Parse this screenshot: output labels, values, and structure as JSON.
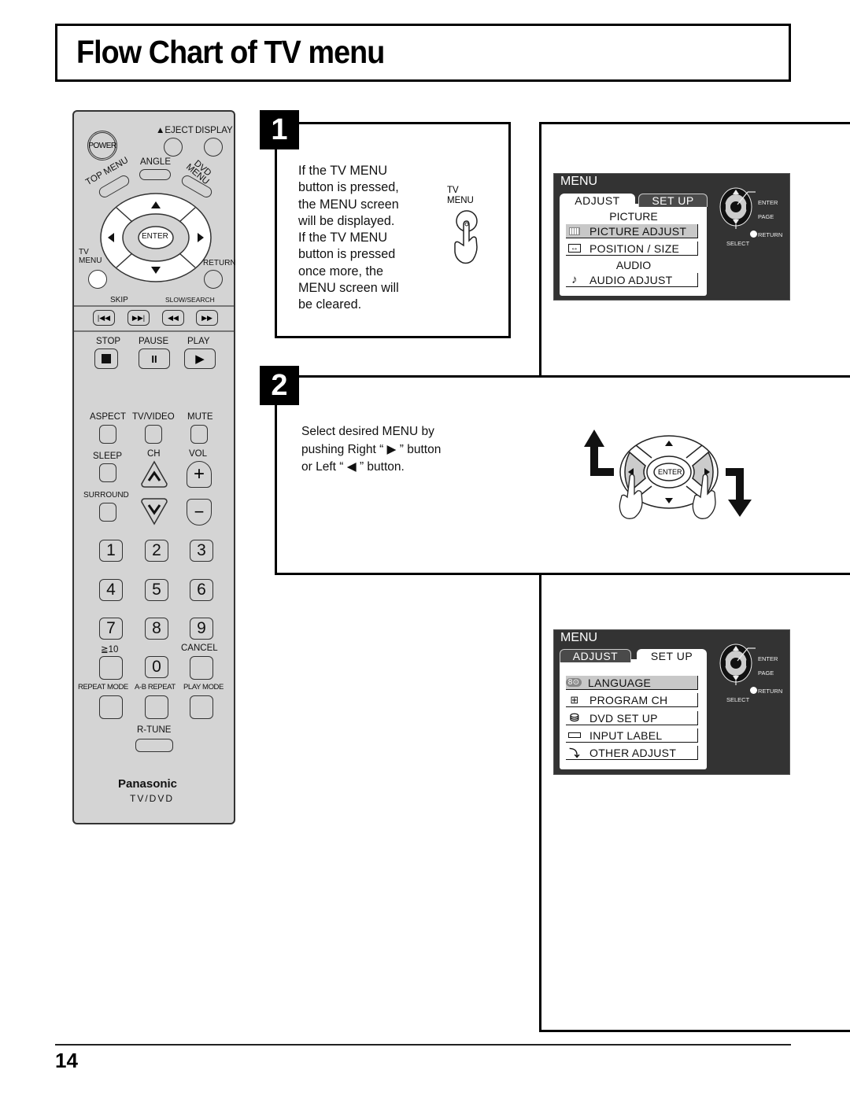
{
  "title": "Flow Chart of TV menu",
  "page_number": "14",
  "remote": {
    "power": "POWER",
    "eject": "▲EJECT",
    "display": "DISPLAY",
    "angle": "ANGLE",
    "top_menu": "TOP MENU",
    "dvd_menu": "DVD MENU",
    "enter": "ENTER",
    "tv_menu_line1": "TV",
    "tv_menu_line2": "MENU",
    "return": "RETURN",
    "skip": "SKIP",
    "slow_search": "SLOW/SEARCH",
    "stop": "STOP",
    "pause": "PAUSE",
    "play": "PLAY",
    "aspect": "ASPECT",
    "tv_video": "TV/VIDEO",
    "mute": "MUTE",
    "sleep": "SLEEP",
    "ch": "CH",
    "vol": "VOL",
    "surround": "SURROUND",
    "numbers": [
      "1",
      "2",
      "3",
      "4",
      "5",
      "6",
      "7",
      "8",
      "9",
      "0"
    ],
    "ge10": "≧10",
    "cancel": "CANCEL",
    "repeat_mode": "REPEAT MODE",
    "ab_repeat": "A-B REPEAT",
    "play_mode": "PLAY MODE",
    "r_tune": "R-TUNE",
    "brand": "Panasonic",
    "model": "TV/DVD"
  },
  "step1": {
    "number": "1",
    "lines": [
      "If the TV MENU",
      "button is pressed,",
      "the MENU screen",
      "will be displayed.",
      "If the TV MENU",
      "button is pressed",
      "once more, the",
      "MENU screen will",
      "be cleared."
    ],
    "button_label_line1": "TV",
    "button_label_line2": "MENU"
  },
  "step2": {
    "number": "2",
    "lines": [
      "Select desired MENU by",
      "pushing Right “ ▶ ” button",
      "or Left “ ◀ ” button."
    ],
    "enter_label": "ENTER"
  },
  "menu_adjust": {
    "title": "MENU",
    "tabs": [
      {
        "label": "ADJUST",
        "active": true
      },
      {
        "label": "SET UP",
        "active": false
      }
    ],
    "sections": [
      {
        "heading": "PICTURE",
        "items": [
          {
            "icon": "picture-adjust-icon",
            "label": "PICTURE ADJUST",
            "highlighted": true
          },
          {
            "icon": "position-size-icon",
            "label": "POSITION / SIZE",
            "highlighted": false
          }
        ]
      },
      {
        "heading": "AUDIO",
        "items": [
          {
            "icon": "music-note-icon",
            "label": "AUDIO ADJUST",
            "highlighted": false
          }
        ]
      }
    ],
    "legend": {
      "enter": "ENTER",
      "page": "PAGE",
      "return": "RETURN",
      "select": "SELECT"
    }
  },
  "menu_setup": {
    "title": "MENU",
    "tabs": [
      {
        "label": "ADJUST",
        "active": false
      },
      {
        "label": "SET UP",
        "active": true
      }
    ],
    "items": [
      {
        "icon": "language-icon",
        "label": "LANGUAGE",
        "highlighted": true
      },
      {
        "icon": "program-ch-icon",
        "label": "PROGRAM CH",
        "highlighted": false
      },
      {
        "icon": "dvd-setup-icon",
        "label": "DVD SET UP",
        "highlighted": false
      },
      {
        "icon": "input-label-icon",
        "label": "INPUT LABEL",
        "highlighted": false
      },
      {
        "icon": "other-adjust-icon",
        "label": "OTHER ADJUST",
        "highlighted": false
      }
    ],
    "legend": {
      "enter": "ENTER",
      "page": "PAGE",
      "return": "RETURN",
      "select": "SELECT"
    }
  }
}
